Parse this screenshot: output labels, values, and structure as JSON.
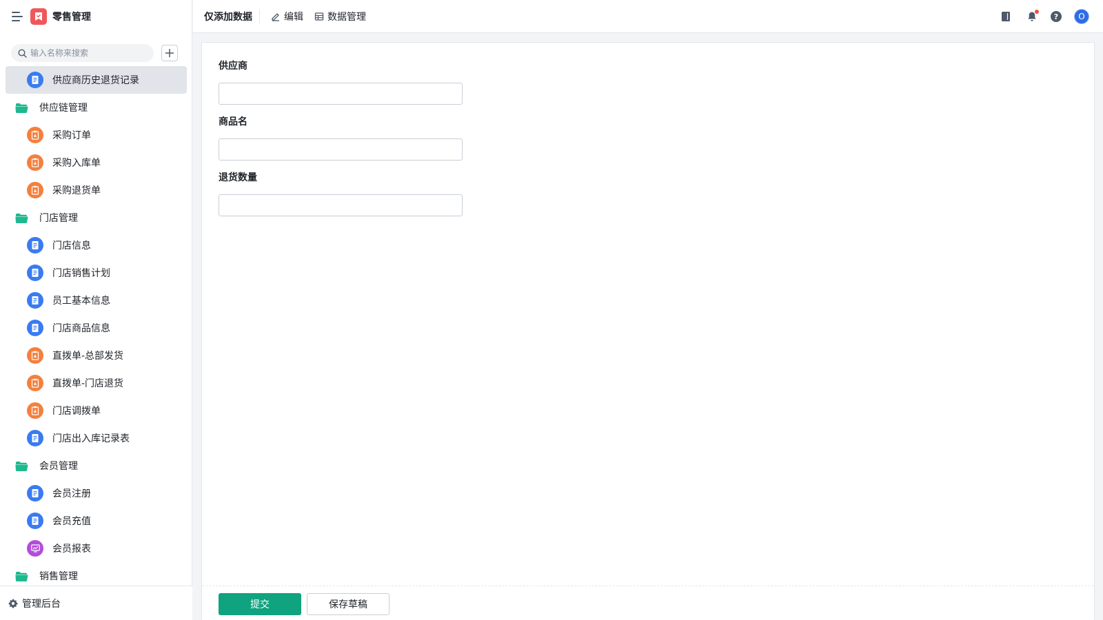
{
  "app": {
    "title": "零售管理",
    "logo_icon": "app-logo-icon",
    "brand_color": "#f0575a"
  },
  "search": {
    "placeholder": "输入名称来搜索",
    "value": ""
  },
  "sidebar": {
    "active_item": "供应商历史退货记录",
    "items": [
      {
        "type": "form",
        "icon": "form-icon",
        "color": "blue",
        "label": "供应商历史退货记录",
        "active": true
      },
      {
        "type": "group",
        "icon": "folder-icon",
        "label": "供应链管理"
      },
      {
        "type": "form",
        "icon": "flow-form-icon",
        "color": "orange",
        "label": "采购订单"
      },
      {
        "type": "form",
        "icon": "flow-form-icon",
        "color": "orange",
        "label": "采购入库单"
      },
      {
        "type": "form",
        "icon": "flow-form-icon",
        "color": "orange",
        "label": "采购退货单"
      },
      {
        "type": "group",
        "icon": "folder-icon",
        "label": "门店管理"
      },
      {
        "type": "form",
        "icon": "form-icon",
        "color": "blue",
        "label": "门店信息"
      },
      {
        "type": "form",
        "icon": "form-icon",
        "color": "blue",
        "label": "门店销售计划"
      },
      {
        "type": "form",
        "icon": "form-icon",
        "color": "blue",
        "label": "员工基本信息"
      },
      {
        "type": "form",
        "icon": "form-icon",
        "color": "blue",
        "label": "门店商品信息"
      },
      {
        "type": "form",
        "icon": "flow-form-icon",
        "color": "orange",
        "label": "直拨单-总部发货"
      },
      {
        "type": "form",
        "icon": "flow-form-icon",
        "color": "orange",
        "label": "直拨单-门店退货"
      },
      {
        "type": "form",
        "icon": "flow-form-icon",
        "color": "orange",
        "label": "门店调拨单"
      },
      {
        "type": "form",
        "icon": "form-icon",
        "color": "blue",
        "label": "门店出入库记录表"
      },
      {
        "type": "group",
        "icon": "folder-icon",
        "label": "会员管理"
      },
      {
        "type": "form",
        "icon": "form-icon",
        "color": "blue",
        "label": "会员注册"
      },
      {
        "type": "form",
        "icon": "form-icon",
        "color": "blue",
        "label": "会员充值"
      },
      {
        "type": "form",
        "icon": "dashboard-icon",
        "color": "purple",
        "label": "会员报表"
      },
      {
        "type": "group",
        "icon": "folder-icon",
        "label": "销售管理"
      }
    ],
    "footer_label": "管理后台"
  },
  "topbar": {
    "page_title": "仅添加数据",
    "edit_label": "编辑",
    "data_manage_label": "数据管理",
    "avatar_text": "O"
  },
  "form": {
    "fields": [
      {
        "label": "供应商",
        "value": ""
      },
      {
        "label": "商品名",
        "value": ""
      },
      {
        "label": "退货数量",
        "value": ""
      }
    ],
    "submit_label": "提交",
    "draft_label": "保存草稿"
  },
  "colors": {
    "accent": "#0fa37f",
    "form_blue": "#3a7bf2",
    "flow_orange": "#f5803e",
    "report_purple": "#b44bdb",
    "folder_green": "#1fb88f",
    "active_bg": "#e1e4e9"
  }
}
